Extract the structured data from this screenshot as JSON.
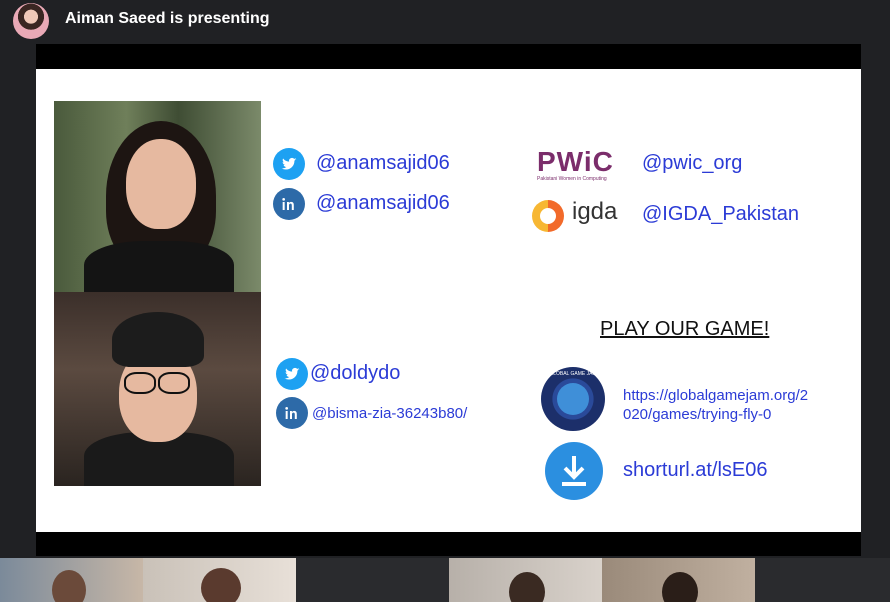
{
  "header": {
    "presenter_text": "Aiman Saeed is presenting"
  },
  "slide": {
    "left_handles": [
      {
        "icon": "twitter-icon",
        "text": "@anamsajid06"
      },
      {
        "icon": "linkedin-icon",
        "text": "@anamsajid06"
      },
      {
        "icon": "twitter-icon",
        "text": "@doldydo"
      },
      {
        "icon": "linkedin-icon",
        "text": "@bisma-zia-36243b80/"
      }
    ],
    "org_logos": {
      "pwic_logo_text": "PWiC",
      "pwic_tagline": "Pakistani Women in Computing",
      "igda_logo_text": "igda"
    },
    "org_handles": [
      "@pwic_org",
      "@IGDA_Pakistan"
    ],
    "play_heading": "PLAY OUR GAME!",
    "ggj_logo_text": "GLOBAL GAME JAM",
    "game_url_line1": "https://globalgamejam.org/2",
    "game_url_line2": "020/games/trying-fly-0",
    "short_url": "shorturl.at/lsE06"
  },
  "colors": {
    "background": "#202124",
    "link_blue": "#2b3bd6",
    "twitter": "#1da1f2",
    "linkedin": "#2d6aa8"
  }
}
